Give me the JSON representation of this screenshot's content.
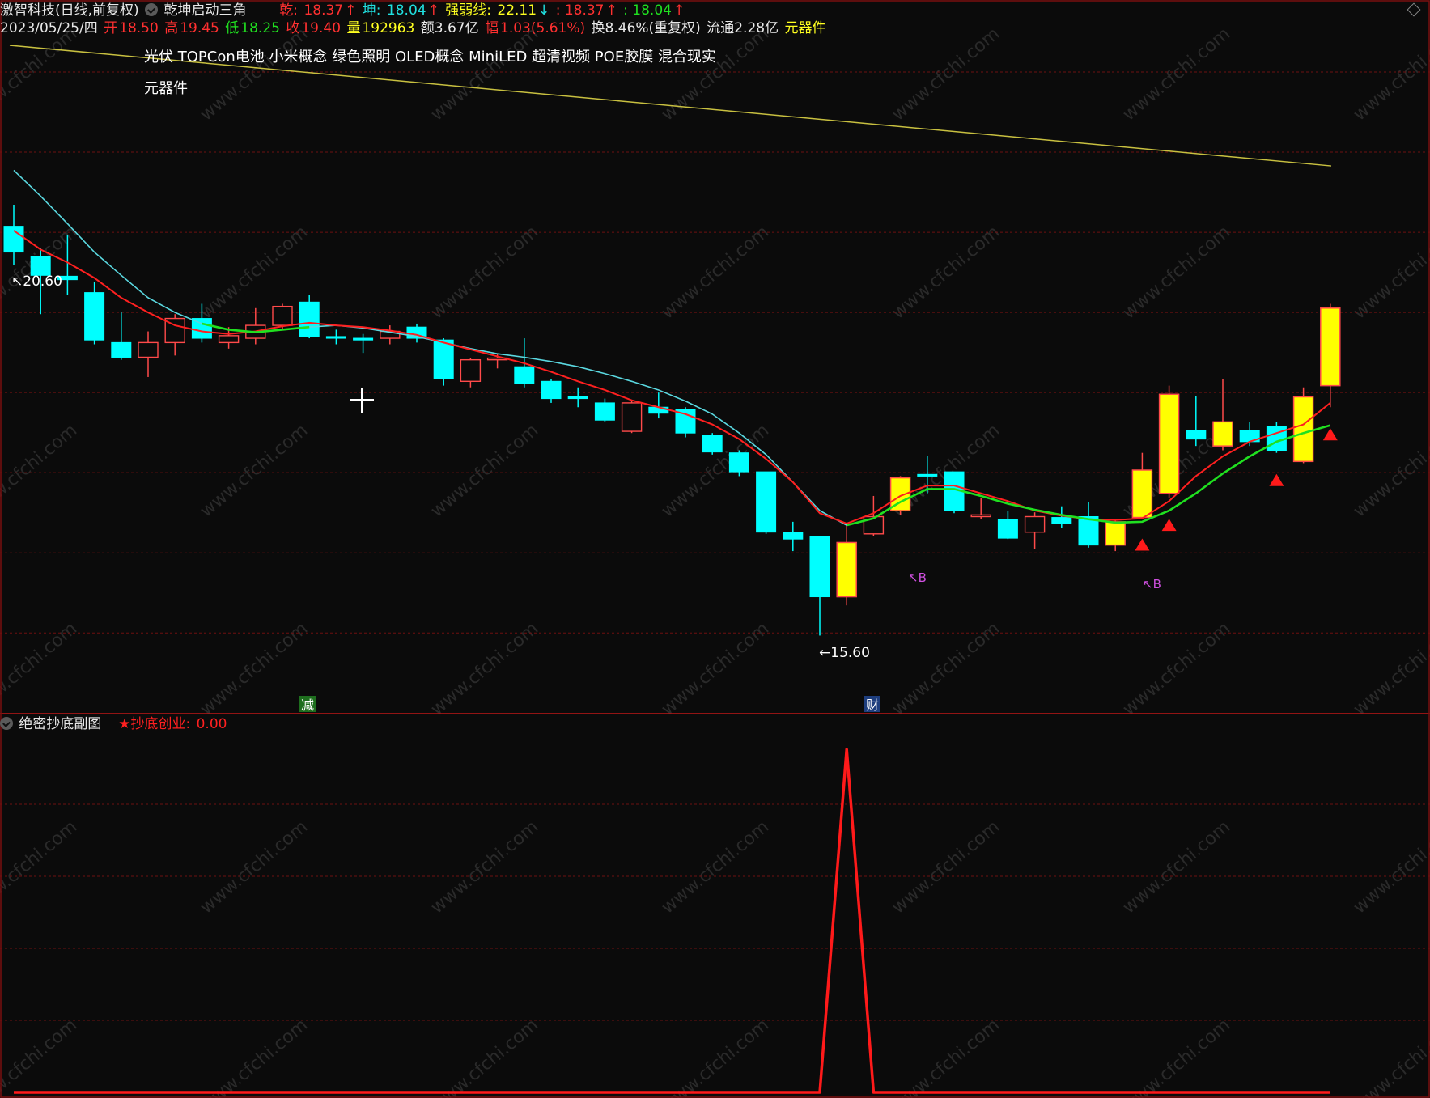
{
  "header": {
    "stock_name": "激智科技(日线,前复权)",
    "indicator_name": "乾坤启动三角",
    "qian_label": "乾: ",
    "qian_value": "18.37",
    "kun_label": "坤: ",
    "kun_value": "18.04",
    "strength_label": "强弱线: ",
    "strength_value": "22.11",
    "extra1_value": ": 18.37",
    "extra2_value": ": 18.04"
  },
  "quote": {
    "date": "2023/05/25/四",
    "open_label": "开",
    "open": "18.50",
    "high_label": "高",
    "high": "19.45",
    "low_label": "低",
    "low": "18.25",
    "close_label": "收",
    "close": "19.40",
    "volume_label": "量",
    "volume": "192963",
    "amount": "额3.67亿",
    "change_label": "幅",
    "change": "1.03(5.61%)",
    "turnover": "换8.46%(重复权)",
    "float": "流通2.28亿",
    "sector": "元器件"
  },
  "concept_tags": [
    "光伏",
    "TOPCon电池",
    "小米概念",
    "绿色照明",
    "OLED概念",
    "MiniLED",
    "超清视频",
    "POE胶膜",
    "混合现实"
  ],
  "concept_tags_line2": "元器件",
  "annotations": {
    "high_label": "20.60",
    "low_label": "15.60",
    "buy_label": "B",
    "event_jian": "减",
    "event_cai": "财"
  },
  "sub_panel": {
    "title": "绝密抄底副图",
    "indicator_label": "★抄底创业: ",
    "indicator_value": "0.00"
  },
  "watermark": "www.cfchi.com",
  "colors": {
    "background": "#0b0b0b",
    "up_candle": "#ff4a4a",
    "down_candle": "#00ffff",
    "highlight_candle": "#ffff00",
    "ma_red": "#ff2020",
    "ma_green": "#20e020",
    "ma_cyan": "#5ad8e0",
    "trend_line": "#c8c040",
    "grid": "#6e1010",
    "signal": "#ff1a1a"
  },
  "chart_data": {
    "type": "candlestick",
    "y_range": [
      14.9,
      22.6
    ],
    "candles": [
      {
        "open": 20.35,
        "close": 20.05,
        "high": 20.6,
        "low": 19.9
      },
      {
        "open": 20.0,
        "close": 19.78,
        "high": 20.1,
        "low": 19.33
      },
      {
        "open": 19.77,
        "close": 19.73,
        "high": 20.25,
        "low": 19.55
      },
      {
        "open": 19.58,
        "close": 19.03,
        "high": 19.7,
        "low": 18.98
      },
      {
        "open": 19.0,
        "close": 18.83,
        "high": 19.35,
        "low": 18.8
      },
      {
        "open": 18.83,
        "close": 19.0,
        "high": 19.13,
        "low": 18.6
      },
      {
        "open": 19.0,
        "close": 19.28,
        "high": 19.33,
        "low": 18.85
      },
      {
        "open": 19.28,
        "close": 19.05,
        "high": 19.45,
        "low": 19.0
      },
      {
        "open": 19.0,
        "close": 19.08,
        "high": 19.18,
        "low": 18.93
      },
      {
        "open": 19.05,
        "close": 19.2,
        "high": 19.4,
        "low": 18.98
      },
      {
        "open": 19.2,
        "close": 19.42,
        "high": 19.45,
        "low": 19.15
      },
      {
        "open": 19.47,
        "close": 19.07,
        "high": 19.55,
        "low": 19.05
      },
      {
        "open": 19.07,
        "close": 19.05,
        "high": 19.15,
        "low": 18.98
      },
      {
        "open": 19.05,
        "close": 19.03,
        "high": 19.1,
        "low": 18.88
      },
      {
        "open": 19.05,
        "close": 19.13,
        "high": 19.2,
        "low": 18.98
      },
      {
        "open": 19.18,
        "close": 19.05,
        "high": 19.22,
        "low": 19.0
      },
      {
        "open": 19.03,
        "close": 18.58,
        "high": 19.05,
        "low": 18.5
      },
      {
        "open": 18.55,
        "close": 18.8,
        "high": 18.82,
        "low": 18.48
      },
      {
        "open": 18.8,
        "close": 18.82,
        "high": 18.87,
        "low": 18.7
      },
      {
        "open": 18.72,
        "close": 18.52,
        "high": 19.05,
        "low": 18.48
      },
      {
        "open": 18.55,
        "close": 18.35,
        "high": 18.58,
        "low": 18.3
      },
      {
        "open": 18.37,
        "close": 18.35,
        "high": 18.48,
        "low": 18.25
      },
      {
        "open": 18.3,
        "close": 18.1,
        "high": 18.35,
        "low": 18.08
      },
      {
        "open": 17.97,
        "close": 18.3,
        "high": 18.32,
        "low": 17.95
      },
      {
        "open": 18.25,
        "close": 18.18,
        "high": 18.42,
        "low": 18.12
      },
      {
        "open": 18.22,
        "close": 17.95,
        "high": 18.25,
        "low": 17.9
      },
      {
        "open": 17.92,
        "close": 17.73,
        "high": 17.95,
        "low": 17.7
      },
      {
        "open": 17.72,
        "close": 17.5,
        "high": 17.75,
        "low": 17.45
      },
      {
        "open": 17.5,
        "close": 16.8,
        "high": 17.5,
        "low": 16.78
      },
      {
        "open": 16.8,
        "close": 16.72,
        "high": 16.92,
        "low": 16.58
      },
      {
        "open": 16.75,
        "close": 16.05,
        "high": 16.75,
        "low": 15.6
      },
      {
        "open": 16.05,
        "close": 16.68,
        "high": 16.9,
        "low": 15.95
      },
      {
        "open": 16.78,
        "close": 16.98,
        "high": 17.22,
        "low": 16.75
      },
      {
        "open": 17.05,
        "close": 17.43,
        "high": 17.45,
        "low": 17.0
      },
      {
        "open": 17.47,
        "close": 17.45,
        "high": 17.68,
        "low": 17.25
      },
      {
        "open": 17.5,
        "close": 17.05,
        "high": 17.5,
        "low": 17.02
      },
      {
        "open": 16.98,
        "close": 17.0,
        "high": 17.2,
        "low": 16.95
      },
      {
        "open": 16.95,
        "close": 16.73,
        "high": 17.05,
        "low": 16.72
      },
      {
        "open": 16.8,
        "close": 16.98,
        "high": 17.03,
        "low": 16.6
      },
      {
        "open": 16.97,
        "close": 16.9,
        "high": 17.1,
        "low": 16.85
      },
      {
        "open": 16.98,
        "close": 16.65,
        "high": 17.15,
        "low": 16.62
      },
      {
        "open": 16.65,
        "close": 16.92,
        "high": 16.95,
        "low": 16.58
      },
      {
        "open": 16.97,
        "close": 17.52,
        "high": 17.72,
        "low": 16.97
      },
      {
        "open": 17.25,
        "close": 18.4,
        "high": 18.5,
        "low": 17.2
      },
      {
        "open": 17.98,
        "close": 17.88,
        "high": 18.38,
        "low": 17.8
      },
      {
        "open": 17.8,
        "close": 18.08,
        "high": 18.58,
        "low": 17.75
      },
      {
        "open": 17.98,
        "close": 17.85,
        "high": 18.08,
        "low": 17.8
      },
      {
        "open": 18.03,
        "close": 17.75,
        "high": 18.08,
        "low": 17.72
      },
      {
        "open": 17.62,
        "close": 18.37,
        "high": 18.48,
        "low": 17.6
      },
      {
        "open": 18.5,
        "close": 19.4,
        "high": 19.45,
        "low": 18.25
      }
    ],
    "ma_short": [
      20.3,
      20.08,
      19.93,
      19.75,
      19.52,
      19.35,
      19.2,
      19.13,
      19.1,
      19.13,
      19.19,
      19.23,
      19.2,
      19.18,
      19.14,
      19.09,
      19.0,
      18.92,
      18.84,
      18.76,
      18.66,
      18.55,
      18.45,
      18.33,
      18.25,
      18.17,
      18.05,
      17.88,
      17.65,
      17.38,
      17.02,
      16.9,
      17.02,
      17.22,
      17.34,
      17.34,
      17.25,
      17.16,
      17.05,
      16.99,
      16.95,
      16.94,
      16.96,
      17.16,
      17.45,
      17.68,
      17.85,
      17.95,
      18.05,
      18.3
    ],
    "ma_long": [
      21.0,
      20.7,
      20.38,
      20.05,
      19.78,
      19.52,
      19.35,
      19.22,
      19.15,
      19.12,
      19.15,
      19.18,
      19.2,
      19.17,
      19.12,
      19.07,
      19.0,
      18.93,
      18.87,
      18.83,
      18.78,
      18.72,
      18.64,
      18.55,
      18.45,
      18.32,
      18.17,
      17.95,
      17.7,
      17.38,
      17.05,
      16.88,
      16.96,
      17.15,
      17.3,
      17.3,
      17.22,
      17.13,
      17.06,
      17.0,
      16.95,
      16.91,
      16.92,
      17.05,
      17.25,
      17.48,
      17.68,
      17.85,
      17.95,
      18.04
    ],
    "green_segments": [
      [
        7,
        11
      ],
      [
        31,
        50
      ]
    ],
    "up_triangles_below": [
      42,
      43,
      47,
      49
    ],
    "buy_marks": [
      32,
      42
    ],
    "trend_line": {
      "start": 22.45,
      "end": 21.05
    },
    "grid_levels": [
      22.14,
      21.21,
      20.28,
      19.35,
      18.42,
      17.49,
      16.56,
      15.63
    ],
    "sub_series": {
      "y_range": [
        0,
        105
      ],
      "spike_index": 31,
      "spike_value": 100,
      "base_value": 0
    }
  }
}
